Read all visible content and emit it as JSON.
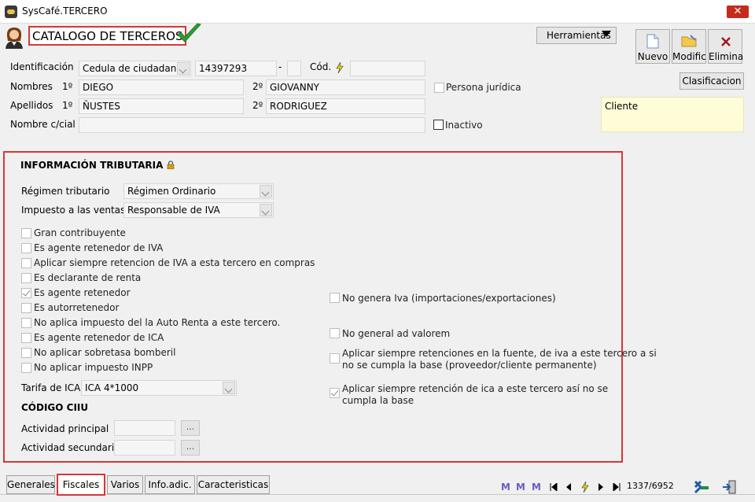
{
  "window": {
    "title": "SysCafé.TERCERO",
    "close": "✕"
  },
  "header": {
    "title": "CATALOGO DE TERCEROS",
    "tools_label": "Herramientas",
    "buttons": {
      "nuevo": "Nuevo",
      "modif": "Modific",
      "elimina": "Elimina"
    },
    "clasificacion": "Clasificacion"
  },
  "form": {
    "identificacion_label": "Identificación",
    "tipo_doc": "Cedula de ciudadania",
    "numero": "14397293",
    "dash": "-",
    "cod_label": "Cód.",
    "nombres_label": "Nombres",
    "ordinal_1": "1º",
    "ordinal_2": "2º",
    "nombre1": "DIEGO",
    "nombre2": "GIOVANNY",
    "persona_juridica": "Persona jurídica",
    "apellidos_label": "Apellidos",
    "apellido1": "ÑUSTES",
    "apellido2": "RODRIGUEZ",
    "nombre_comercial_label": "Nombre c/cial",
    "inactivo": "Inactivo",
    "cliente": "Cliente"
  },
  "fiscal": {
    "heading": "INFORMACIÓN TRIBUTARIA",
    "regimen_label": "Régimen tributario",
    "regimen_value": "Régimen Ordinario",
    "impuesto_label": "Impuesto a las ventas",
    "impuesto_value": "Responsable de IVA",
    "checks_left": [
      {
        "label": "Gran contribuyente",
        "checked": false
      },
      {
        "label": "Es agente retenedor de IVA",
        "checked": false
      },
      {
        "label": "Aplicar siempre retencion de IVA a esta tercero en compras",
        "checked": false
      },
      {
        "label": "Es declarante de renta",
        "checked": false
      },
      {
        "label": "Es agente retenedor",
        "checked": true
      },
      {
        "label": "Es autorretenedor",
        "checked": false
      },
      {
        "label": "No aplica impuesto del la Auto Renta a este tercero.",
        "checked": false
      },
      {
        "label": "Es agente retenedor de ICA",
        "checked": false
      },
      {
        "label": "No aplicar sobretasa bomberil",
        "checked": false
      },
      {
        "label": "No aplicar impuesto INPP",
        "checked": false
      }
    ],
    "no_genera_iva": "No genera Iva (importaciones/exportaciones)",
    "no_ad_valorem": "No general ad valorem",
    "ret_fuente_1": "Aplicar siempre retenciones en la fuente, de iva  a este tercero a si",
    "ret_fuente_2": "no se cumpla la base (proveedor/cliente permanente)",
    "ret_ica_1": "Aplicar siempre retención de ica a este tercero así no se",
    "ret_ica_2": "cumpla la base",
    "ret_ica_checked": true,
    "tarifa_label": "Tarifa de ICA",
    "tarifa_value": "ICA 4*1000",
    "ciiu_heading": "CÓDIGO CIIU",
    "actividad_principal": "Actividad principal",
    "actividad_secundaria": "Actividad secundaria",
    "dots": "..."
  },
  "tabs": [
    "Generales",
    "Fiscales",
    "Varios",
    "Info.adic.",
    "Caracteristicas"
  ],
  "nav": {
    "record": "1337/6952"
  },
  "colors": {
    "highlight_border": "#d93636",
    "cliente_bg": "#fffdd8",
    "check_green": "#2e9e2e"
  }
}
